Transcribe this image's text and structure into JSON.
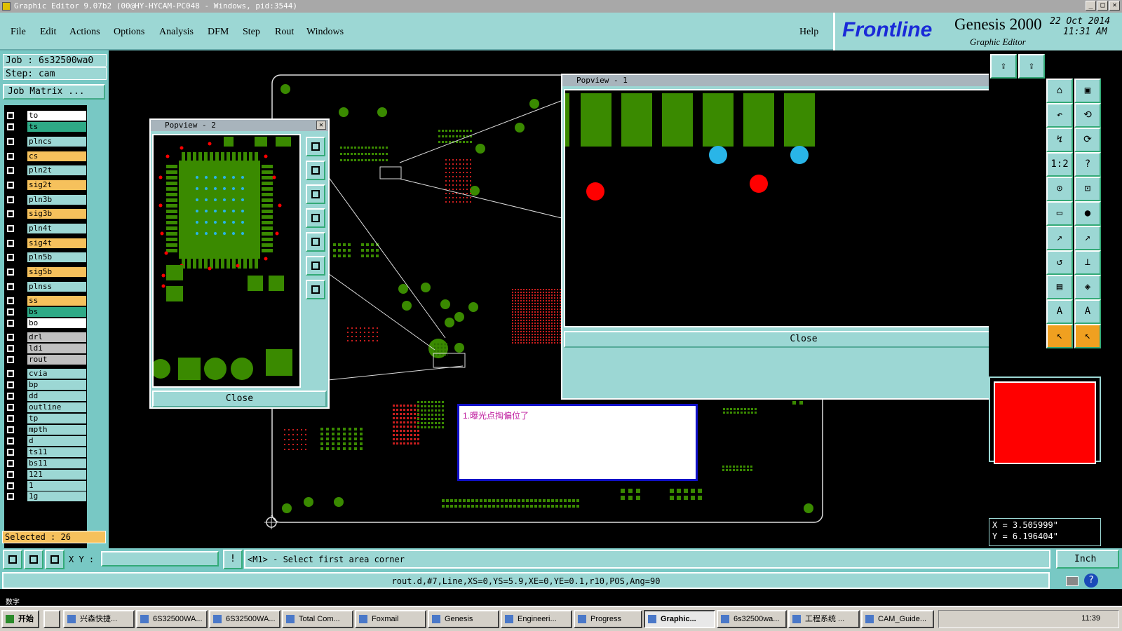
{
  "window": {
    "title": "Graphic Editor 9.07b2 (00@HY-HYCAM-PC048 - Windows, pid:3544)",
    "minimize": "_",
    "maximize": "□",
    "close": "✕"
  },
  "menu": {
    "items": [
      "File",
      "Edit",
      "Actions",
      "Options",
      "Analysis",
      "DFM",
      "Step",
      "Rout",
      "Windows"
    ],
    "help": "Help"
  },
  "brand": {
    "logo": "Frontline",
    "product": "Genesis 2000",
    "subtitle": "Graphic Editor",
    "date": "22 Oct 2014",
    "time": "11:31 AM"
  },
  "job": {
    "job_label": "Job : 6s32500wa0",
    "step_label": "Step: cam",
    "matrix_button": "Job Matrix ..."
  },
  "layers": [
    {
      "name": "to",
      "color": "#ffffff"
    },
    {
      "name": "ts",
      "color": "#2eaa86"
    },
    {
      "name": "plncs",
      "color": "#9cd7d4"
    },
    {
      "name": "cs",
      "color": "#f6c15c"
    },
    {
      "name": "pln2t",
      "color": "#9cd7d4"
    },
    {
      "name": "sig2t",
      "color": "#f6c15c"
    },
    {
      "name": "pln3b",
      "color": "#9cd7d4"
    },
    {
      "name": "sig3b",
      "color": "#f6c15c"
    },
    {
      "name": "pln4t",
      "color": "#9cd7d4"
    },
    {
      "name": "sig4t",
      "color": "#f6c15c"
    },
    {
      "name": "pln5b",
      "color": "#9cd7d4"
    },
    {
      "name": "sig5b",
      "color": "#f6c15c"
    },
    {
      "name": "plnss",
      "color": "#9cd7d4"
    },
    {
      "name": "ss",
      "color": "#f6c15c"
    },
    {
      "name": "bs",
      "color": "#2eaa86"
    },
    {
      "name": "bo",
      "color": "#ffffff"
    },
    {
      "name": "drl",
      "color": "#c0c0c0"
    },
    {
      "name": "ldi",
      "color": "#c0c0c0"
    },
    {
      "name": "rout",
      "color": "#c0c0c0"
    },
    {
      "name": "cvia",
      "color": "#9cd7d4"
    },
    {
      "name": "bp",
      "color": "#9cd7d4"
    },
    {
      "name": "dd",
      "color": "#9cd7d4"
    },
    {
      "name": "outline",
      "color": "#9cd7d4"
    },
    {
      "name": "tp",
      "color": "#9cd7d4"
    },
    {
      "name": "mpth",
      "color": "#9cd7d4"
    },
    {
      "name": "d",
      "color": "#9cd7d4"
    },
    {
      "name": "ts11",
      "color": "#9cd7d4"
    },
    {
      "name": "bs11",
      "color": "#9cd7d4"
    },
    {
      "name": "121",
      "color": "#9cd7d4"
    },
    {
      "name": "1",
      "color": "#9cd7d4"
    },
    {
      "name": "1g",
      "color": "#9cd7d4"
    }
  ],
  "selected": "Selected : 26",
  "popview2": {
    "title": "Popview - 2",
    "close": "Close"
  },
  "popview1": {
    "title": "Popview - 1",
    "close": "Close"
  },
  "note": "1.曝光点掏偏位了",
  "coords": {
    "x": "X = 3.505999\"",
    "y": "Y = 6.196404\""
  },
  "cmd": {
    "xy_label": "X Y :",
    "xy_value": "",
    "prompt": "<M1> - Select first area corner",
    "units": "Inch"
  },
  "status": "rout.d,#7,Line,XS=0,YS=5.9,XE=0,YE=0.1,r10,POS,Ang=90",
  "taskbar": {
    "start": "开始",
    "ime": "数字",
    "tasks": [
      "兴森快捷...",
      "6S32500WA...",
      "6S32500WA...",
      "Total Com...",
      "Foxmail",
      "Genesis",
      "Engineeri...",
      "Progress",
      "Graphic...",
      "6s32500wa...",
      "工程系统 ...",
      "CAM_Guide..."
    ],
    "clock": "11:39"
  },
  "colors": {
    "panel": "#9cd7d4",
    "pad": "#3a8a00",
    "drill": "#ff0000",
    "via": "#29b5e8"
  }
}
